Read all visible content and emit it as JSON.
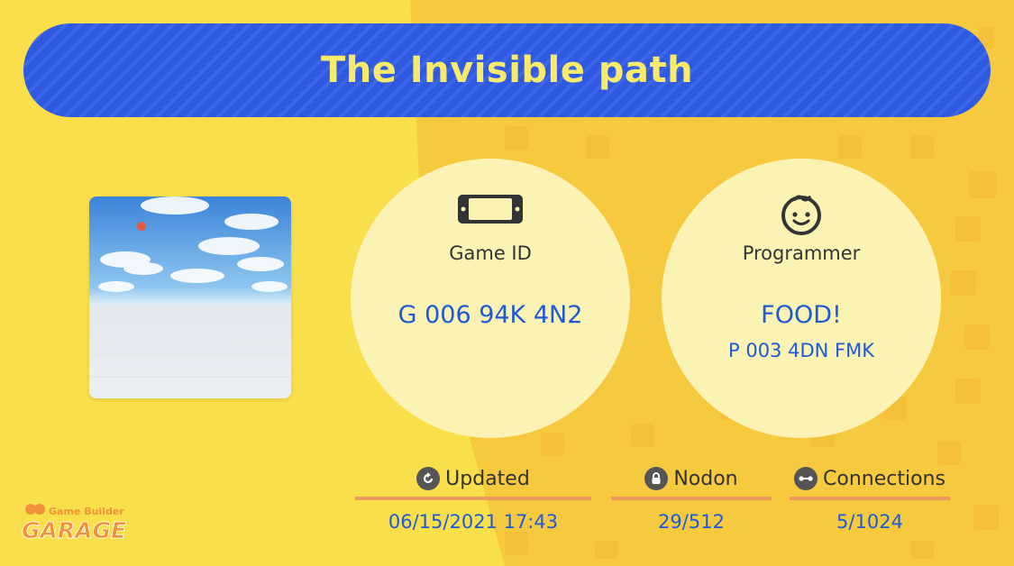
{
  "game": {
    "title": "The Invisible path",
    "id_label": "Game ID",
    "id_value": "G 006 94K 4N2",
    "programmer_label": "Programmer",
    "programmer_name": "FOOD!",
    "programmer_id": "P 003 4DN FMK"
  },
  "stats": {
    "updated_label": "Updated",
    "updated_value": "06/15/2021 17:43",
    "nodon_label": "Nodon",
    "nodon_value": "29/512",
    "connections_label": "Connections",
    "connections_value": "5/1024"
  },
  "logo": {
    "line1": "Game Builder",
    "line2": "GARAGE"
  },
  "colors": {
    "background": "#f9df4c",
    "background_right": "#f7c93f",
    "title_bar": "#2e59e0",
    "title_text": "#f8ea6a",
    "circle": "#fbf3b4",
    "value_text": "#1f5ad6",
    "underline": "#ec9a5b"
  },
  "icons": {
    "game_id": "switch-console-icon",
    "programmer": "child-face-icon",
    "updated": "refresh-icon",
    "nodon": "lock-icon",
    "connections": "connection-icon"
  }
}
